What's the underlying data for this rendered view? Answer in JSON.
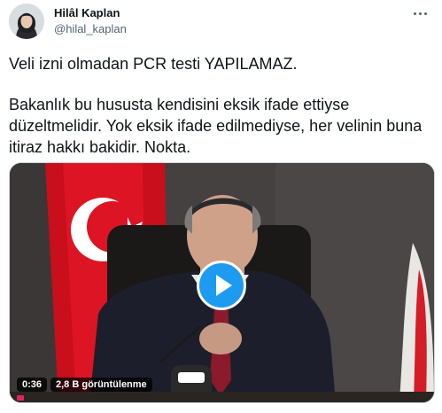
{
  "author": {
    "name": "Hilâl Kaplan",
    "handle": "@hilal_kaplan"
  },
  "tweet": {
    "paragraph_1": "Veli izni olmadan PCR testi YAPILAMAZ.",
    "paragraph_2": "Bakanlık bu hususta kendisini eksik ifade ettiyse düzeltmelidir. Yok eksik ifade edilmediyse, her velinin buna itiraz hakkı bakidir. Nokta."
  },
  "media": {
    "duration": "0:36",
    "views": "2,8 B görüntülenme"
  },
  "colors": {
    "accent": "#1d9bf0",
    "text": "#0f1419",
    "secondary": "#536471",
    "flag_red": "#e30a17"
  },
  "icons": {
    "more": "more-dots-icon",
    "play": "play-icon"
  }
}
